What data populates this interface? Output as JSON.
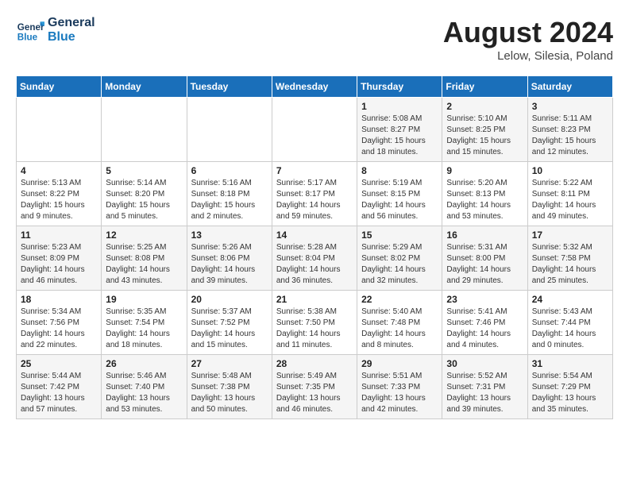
{
  "header": {
    "logo_line1": "General",
    "logo_line2": "Blue",
    "month_year": "August 2024",
    "location": "Lelow, Silesia, Poland"
  },
  "days_of_week": [
    "Sunday",
    "Monday",
    "Tuesday",
    "Wednesday",
    "Thursday",
    "Friday",
    "Saturday"
  ],
  "weeks": [
    [
      {
        "day": "",
        "info": ""
      },
      {
        "day": "",
        "info": ""
      },
      {
        "day": "",
        "info": ""
      },
      {
        "day": "",
        "info": ""
      },
      {
        "day": "1",
        "info": "Sunrise: 5:08 AM\nSunset: 8:27 PM\nDaylight: 15 hours\nand 18 minutes."
      },
      {
        "day": "2",
        "info": "Sunrise: 5:10 AM\nSunset: 8:25 PM\nDaylight: 15 hours\nand 15 minutes."
      },
      {
        "day": "3",
        "info": "Sunrise: 5:11 AM\nSunset: 8:23 PM\nDaylight: 15 hours\nand 12 minutes."
      }
    ],
    [
      {
        "day": "4",
        "info": "Sunrise: 5:13 AM\nSunset: 8:22 PM\nDaylight: 15 hours\nand 9 minutes."
      },
      {
        "day": "5",
        "info": "Sunrise: 5:14 AM\nSunset: 8:20 PM\nDaylight: 15 hours\nand 5 minutes."
      },
      {
        "day": "6",
        "info": "Sunrise: 5:16 AM\nSunset: 8:18 PM\nDaylight: 15 hours\nand 2 minutes."
      },
      {
        "day": "7",
        "info": "Sunrise: 5:17 AM\nSunset: 8:17 PM\nDaylight: 14 hours\nand 59 minutes."
      },
      {
        "day": "8",
        "info": "Sunrise: 5:19 AM\nSunset: 8:15 PM\nDaylight: 14 hours\nand 56 minutes."
      },
      {
        "day": "9",
        "info": "Sunrise: 5:20 AM\nSunset: 8:13 PM\nDaylight: 14 hours\nand 53 minutes."
      },
      {
        "day": "10",
        "info": "Sunrise: 5:22 AM\nSunset: 8:11 PM\nDaylight: 14 hours\nand 49 minutes."
      }
    ],
    [
      {
        "day": "11",
        "info": "Sunrise: 5:23 AM\nSunset: 8:09 PM\nDaylight: 14 hours\nand 46 minutes."
      },
      {
        "day": "12",
        "info": "Sunrise: 5:25 AM\nSunset: 8:08 PM\nDaylight: 14 hours\nand 43 minutes."
      },
      {
        "day": "13",
        "info": "Sunrise: 5:26 AM\nSunset: 8:06 PM\nDaylight: 14 hours\nand 39 minutes."
      },
      {
        "day": "14",
        "info": "Sunrise: 5:28 AM\nSunset: 8:04 PM\nDaylight: 14 hours\nand 36 minutes."
      },
      {
        "day": "15",
        "info": "Sunrise: 5:29 AM\nSunset: 8:02 PM\nDaylight: 14 hours\nand 32 minutes."
      },
      {
        "day": "16",
        "info": "Sunrise: 5:31 AM\nSunset: 8:00 PM\nDaylight: 14 hours\nand 29 minutes."
      },
      {
        "day": "17",
        "info": "Sunrise: 5:32 AM\nSunset: 7:58 PM\nDaylight: 14 hours\nand 25 minutes."
      }
    ],
    [
      {
        "day": "18",
        "info": "Sunrise: 5:34 AM\nSunset: 7:56 PM\nDaylight: 14 hours\nand 22 minutes."
      },
      {
        "day": "19",
        "info": "Sunrise: 5:35 AM\nSunset: 7:54 PM\nDaylight: 14 hours\nand 18 minutes."
      },
      {
        "day": "20",
        "info": "Sunrise: 5:37 AM\nSunset: 7:52 PM\nDaylight: 14 hours\nand 15 minutes."
      },
      {
        "day": "21",
        "info": "Sunrise: 5:38 AM\nSunset: 7:50 PM\nDaylight: 14 hours\nand 11 minutes."
      },
      {
        "day": "22",
        "info": "Sunrise: 5:40 AM\nSunset: 7:48 PM\nDaylight: 14 hours\nand 8 minutes."
      },
      {
        "day": "23",
        "info": "Sunrise: 5:41 AM\nSunset: 7:46 PM\nDaylight: 14 hours\nand 4 minutes."
      },
      {
        "day": "24",
        "info": "Sunrise: 5:43 AM\nSunset: 7:44 PM\nDaylight: 14 hours\nand 0 minutes."
      }
    ],
    [
      {
        "day": "25",
        "info": "Sunrise: 5:44 AM\nSunset: 7:42 PM\nDaylight: 13 hours\nand 57 minutes."
      },
      {
        "day": "26",
        "info": "Sunrise: 5:46 AM\nSunset: 7:40 PM\nDaylight: 13 hours\nand 53 minutes."
      },
      {
        "day": "27",
        "info": "Sunrise: 5:48 AM\nSunset: 7:38 PM\nDaylight: 13 hours\nand 50 minutes."
      },
      {
        "day": "28",
        "info": "Sunrise: 5:49 AM\nSunset: 7:35 PM\nDaylight: 13 hours\nand 46 minutes."
      },
      {
        "day": "29",
        "info": "Sunrise: 5:51 AM\nSunset: 7:33 PM\nDaylight: 13 hours\nand 42 minutes."
      },
      {
        "day": "30",
        "info": "Sunrise: 5:52 AM\nSunset: 7:31 PM\nDaylight: 13 hours\nand 39 minutes."
      },
      {
        "day": "31",
        "info": "Sunrise: 5:54 AM\nSunset: 7:29 PM\nDaylight: 13 hours\nand 35 minutes."
      }
    ]
  ]
}
